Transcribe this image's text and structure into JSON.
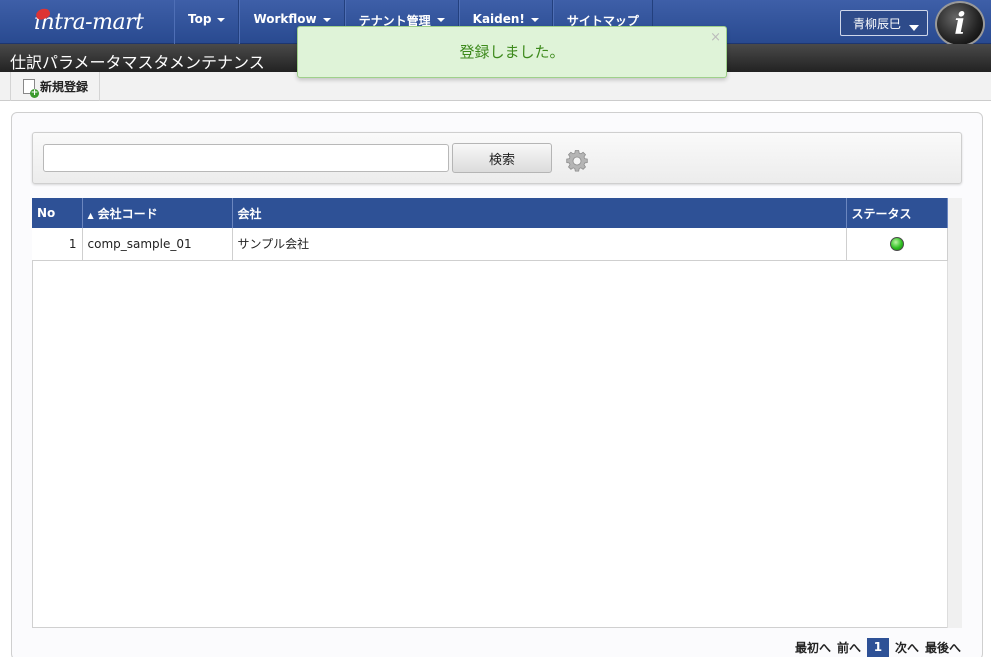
{
  "header": {
    "logo_text": "intra-mart",
    "nav": [
      {
        "label": "Top"
      },
      {
        "label": "Workflow"
      },
      {
        "label": "テナント管理"
      },
      {
        "label": "Kaiden!"
      },
      {
        "label": "サイトマップ"
      }
    ],
    "user_name": "青柳辰巳",
    "info_icon": "i"
  },
  "page_title": "仕訳パラメータマスタメンテナンス",
  "toolbar": {
    "new_label": "新規登録"
  },
  "search": {
    "value": "",
    "placeholder": "",
    "button_label": "検索"
  },
  "table": {
    "columns": [
      "No",
      "会社コード",
      "会社",
      "ステータス"
    ],
    "sorted_column_arrow": "▲",
    "rows": [
      {
        "no": "1",
        "company_code": "comp_sample_01",
        "company": "サンプル会社",
        "status": "active"
      }
    ]
  },
  "pager": {
    "first": "最初へ",
    "prev": "前へ",
    "page": "1",
    "next": "次へ",
    "last": "最後へ"
  },
  "notification": {
    "message": "登録しました。",
    "close": "×"
  },
  "colors": {
    "header_blue": "#2e5196",
    "status_green": "#2fbf22",
    "toast_green": "#dff3d8"
  }
}
